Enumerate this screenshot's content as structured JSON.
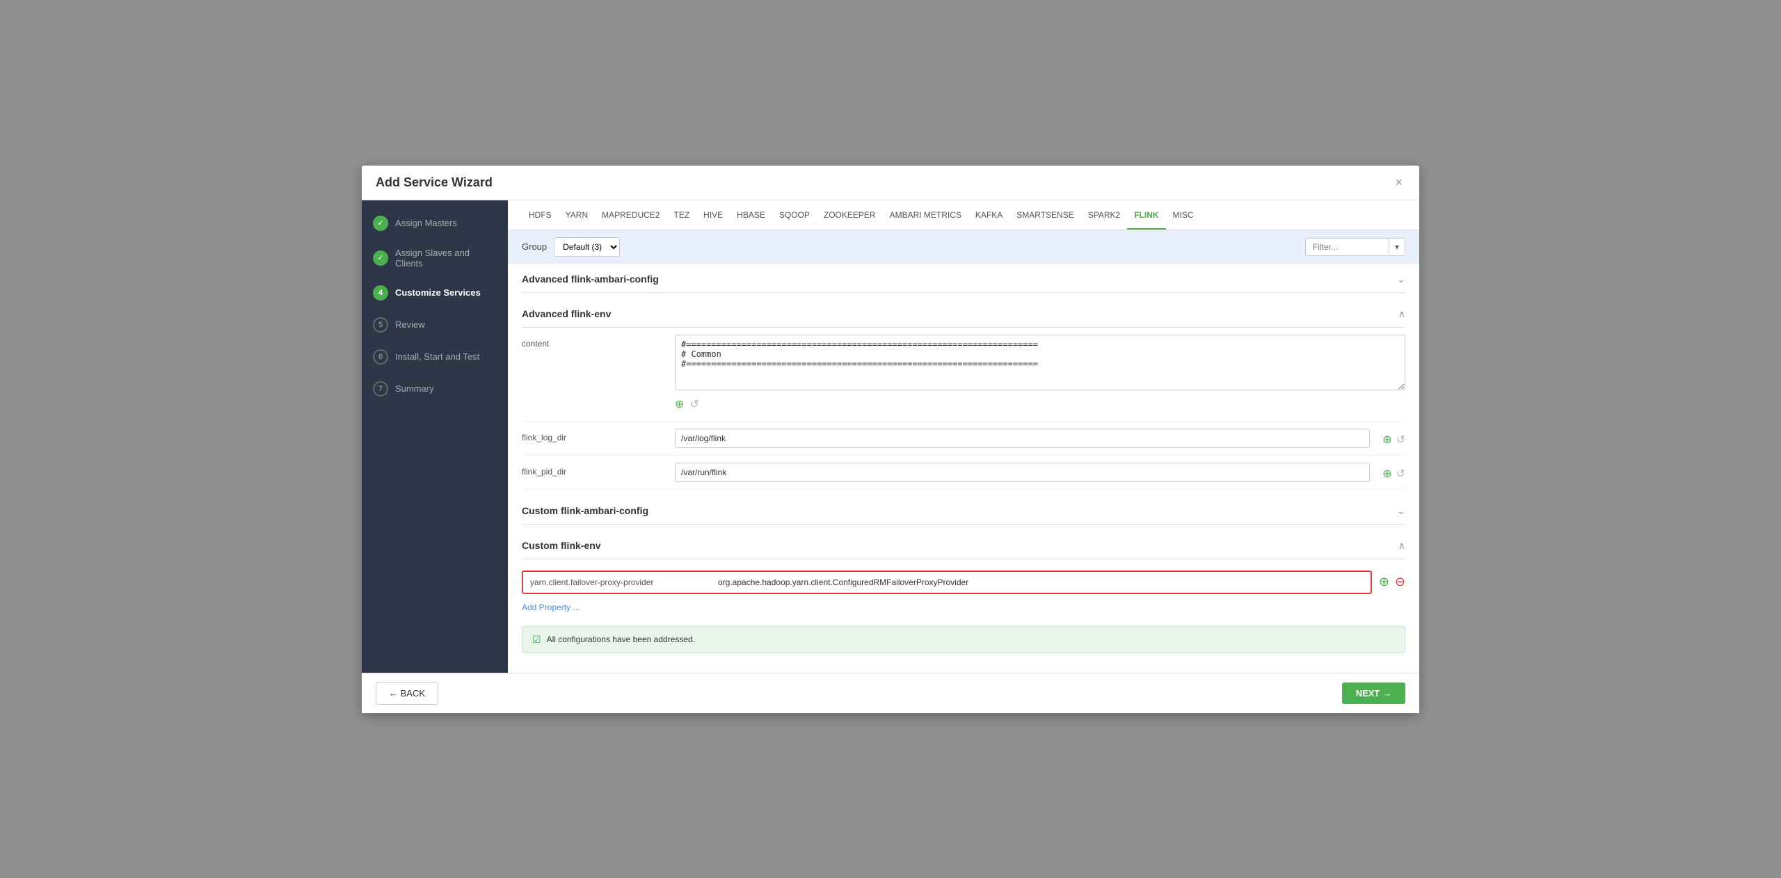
{
  "modal": {
    "title": "Add Service Wizard",
    "close_label": "×"
  },
  "sidebar": {
    "items": [
      {
        "id": "assign-masters",
        "step": "✓",
        "label": "Assign Masters",
        "state": "completed"
      },
      {
        "id": "assign-slaves",
        "step": "✓",
        "label": "Assign Slaves and Clients",
        "state": "completed"
      },
      {
        "id": "customize-services",
        "step": "4",
        "label": "Customize Services",
        "state": "active"
      },
      {
        "id": "review",
        "step": "5",
        "label": "Review",
        "state": "inactive"
      },
      {
        "id": "install-start-test",
        "step": "6",
        "label": "Install, Start and Test",
        "state": "inactive"
      },
      {
        "id": "summary",
        "step": "7",
        "label": "Summary",
        "state": "inactive"
      }
    ]
  },
  "tabs": {
    "items": [
      "HDFS",
      "YARN",
      "MAPREDUCE2",
      "TEZ",
      "HIVE",
      "HBASE",
      "SQOOP",
      "ZOOKEEPER",
      "AMBARI METRICS",
      "KAFKA",
      "SMARTSENSE",
      "SPARK2",
      "FLINK",
      "MISC"
    ],
    "active": "FLINK"
  },
  "filter_bar": {
    "group_label": "Group",
    "group_value": "Default (3)",
    "filter_placeholder": "Filter..."
  },
  "sections": {
    "advanced_flink_ambari_config": {
      "title": "Advanced flink-ambari-config",
      "expanded": false
    },
    "advanced_flink_env": {
      "title": "Advanced flink-env",
      "expanded": true,
      "fields": [
        {
          "id": "content",
          "label": "content",
          "type": "textarea",
          "value": "#======================================================================\n# Common\n#======================================================================"
        },
        {
          "id": "flink_log_dir",
          "label": "flink_log_dir",
          "type": "input",
          "value": "/var/log/flink"
        },
        {
          "id": "flink_pid_dir",
          "label": "flink_pid_dir",
          "type": "input",
          "value": "/var/run/flink"
        }
      ]
    },
    "custom_flink_ambari_config": {
      "title": "Custom flink-ambari-config",
      "expanded": false
    },
    "custom_flink_env": {
      "title": "Custom flink-env",
      "expanded": true,
      "custom_property": {
        "key": "yarn.client.failover-proxy-provider",
        "value": "org.apache.hadoop.yarn.client.ConfiguredRMFailoverProxyProvider"
      },
      "add_property_label": "Add Property ..."
    }
  },
  "success_banner": {
    "text": "All configurations have been addressed."
  },
  "footer": {
    "back_label": "← BACK",
    "next_label": "NEXT →"
  }
}
